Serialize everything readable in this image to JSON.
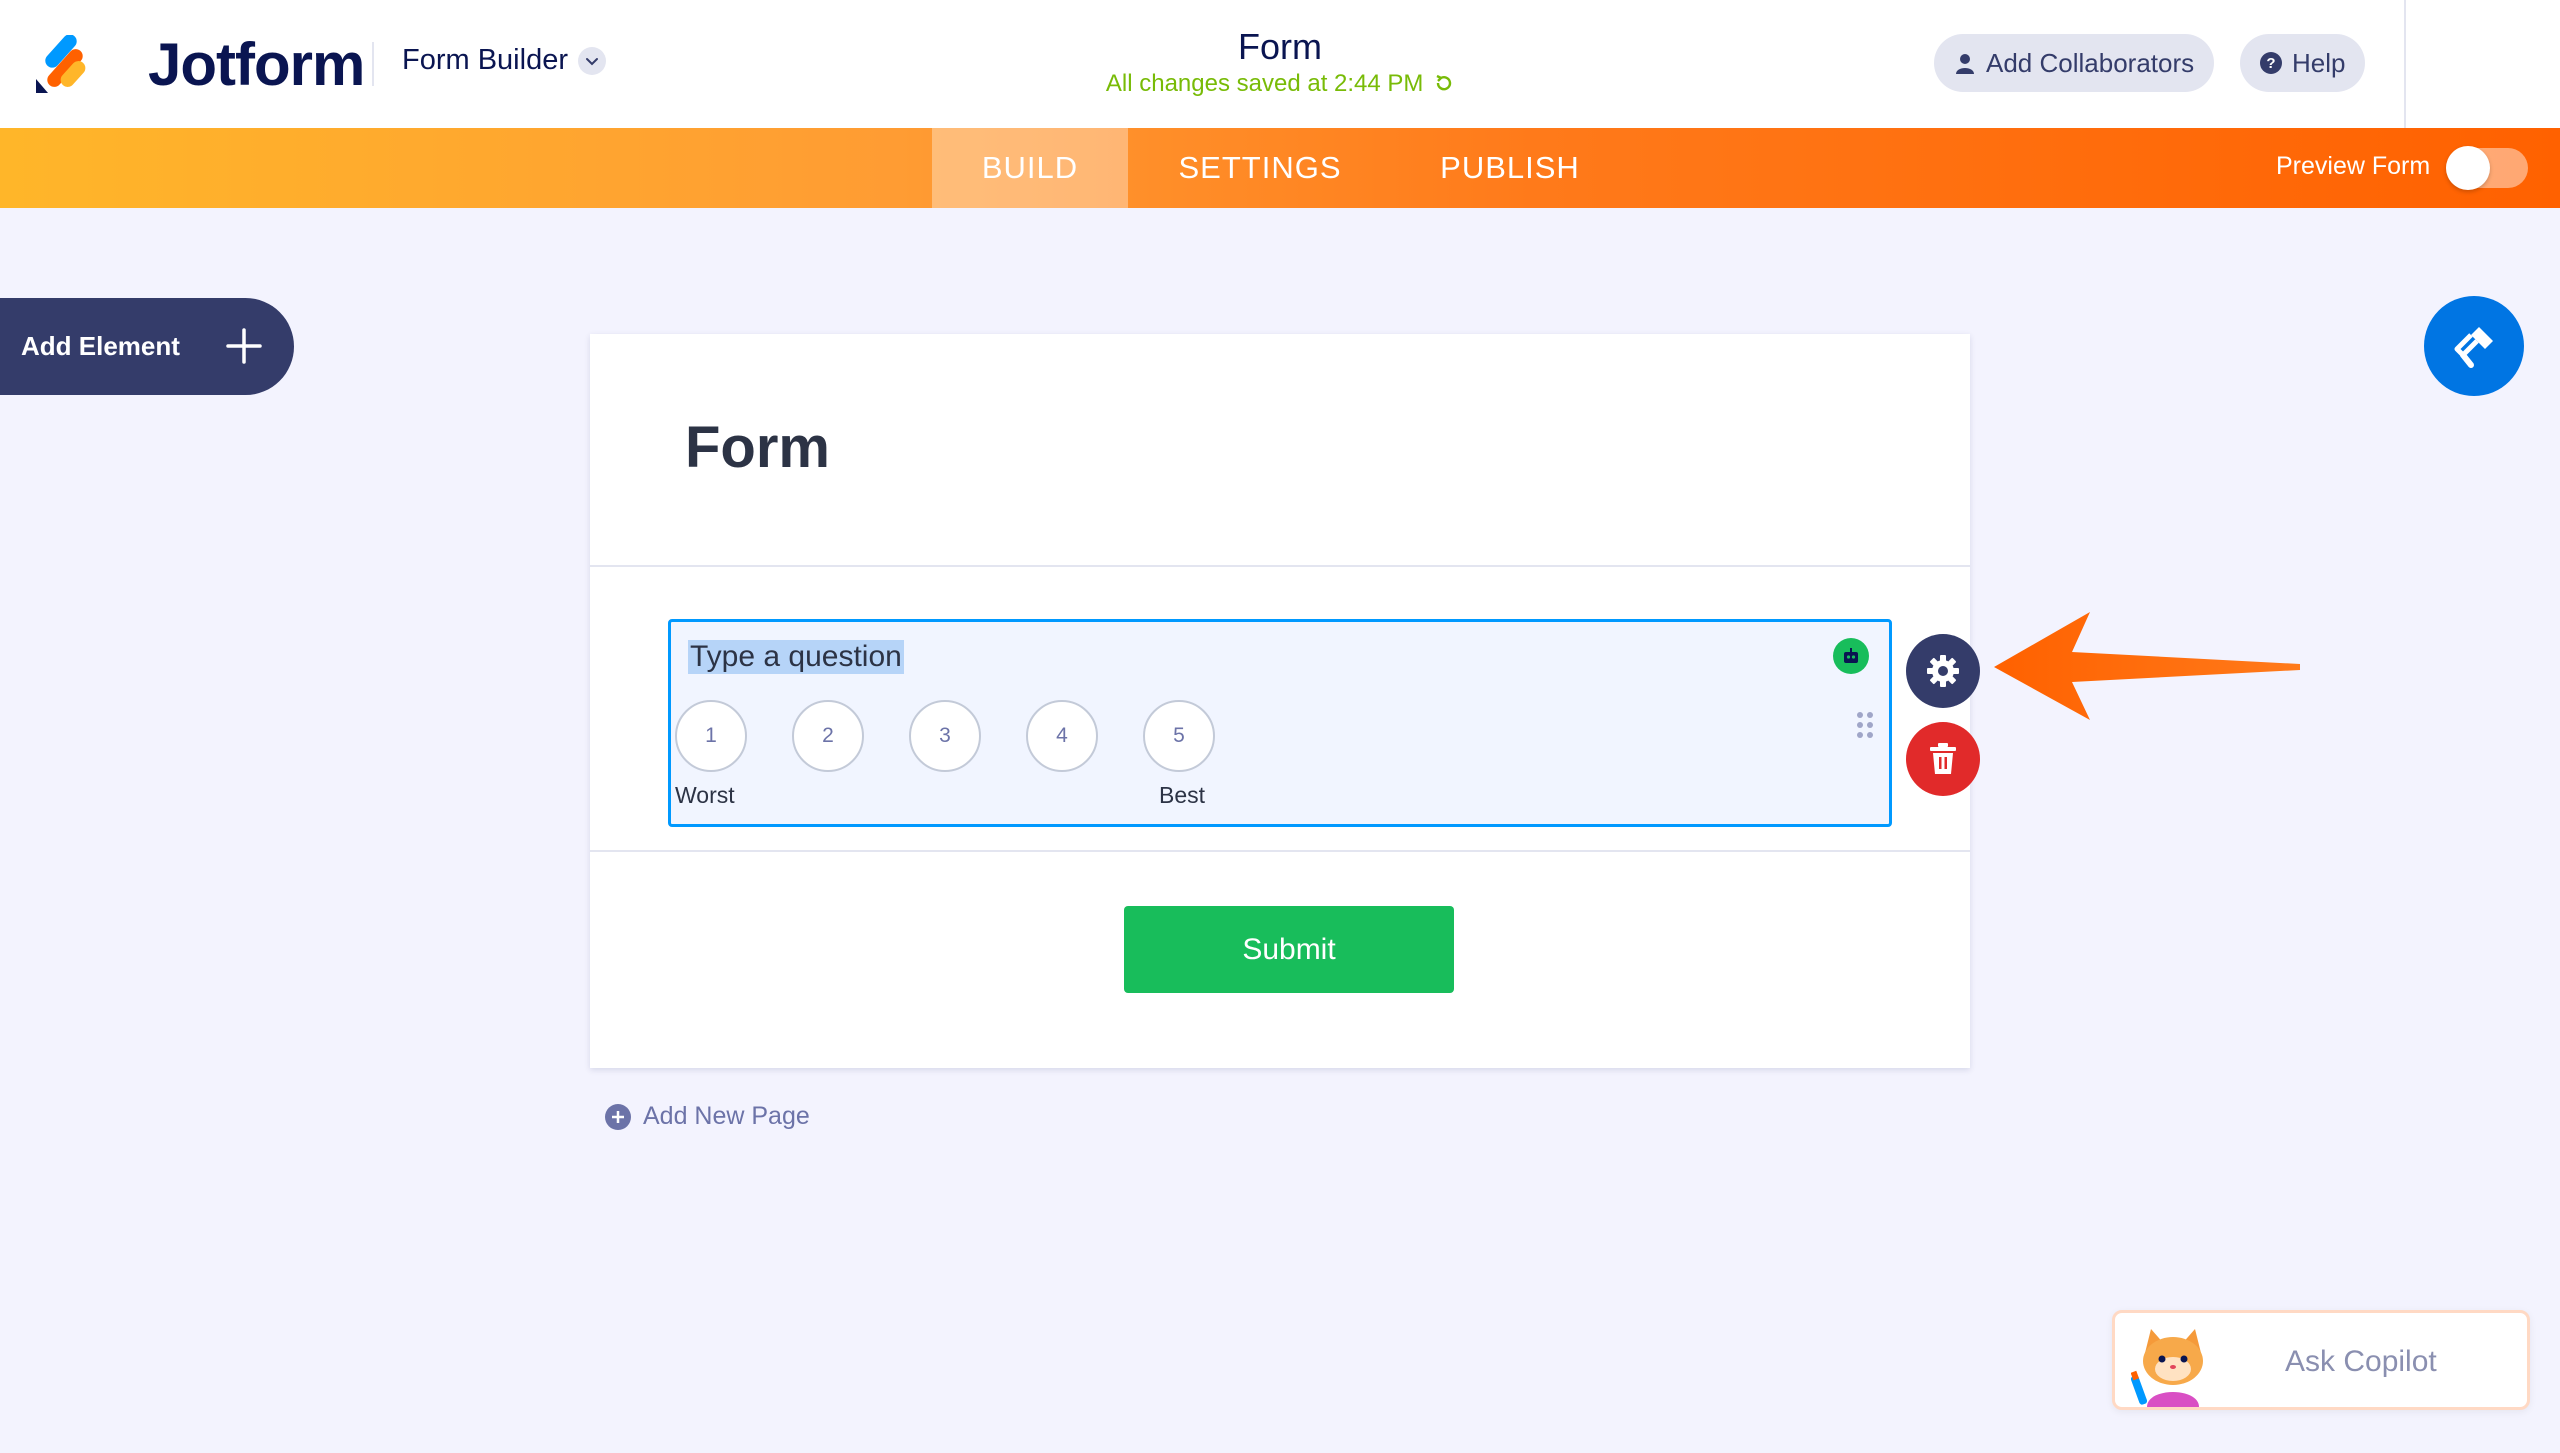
{
  "header": {
    "brand": "Jotform",
    "builder_label": "Form Builder",
    "form_title": "Form",
    "saved_status": "All changes saved at 2:44 PM",
    "add_collaborators": "Add Collaborators",
    "help": "Help"
  },
  "nav": {
    "tabs": [
      {
        "label": "BUILD",
        "active": true
      },
      {
        "label": "SETTINGS",
        "active": false
      },
      {
        "label": "PUBLISH",
        "active": false
      }
    ],
    "preview_label": "Preview Form",
    "preview_on": false
  },
  "sidebar": {
    "add_element_label": "Add Element"
  },
  "form": {
    "heading": "Form",
    "question": {
      "label": "Type a question",
      "scale": [
        "1",
        "2",
        "3",
        "4",
        "5"
      ],
      "low_label": "Worst",
      "high_label": "Best"
    },
    "submit_label": "Submit",
    "add_page_label": "Add New Page"
  },
  "copilot": {
    "label": "Ask Copilot"
  },
  "colors": {
    "brand_navy": "#0a1551",
    "accent_orange": "#ff6100",
    "selection_blue": "#0099ff",
    "submit_green": "#18bd5b",
    "delete_red": "#e12a2a",
    "designer_blue": "#0075e3",
    "saved_green": "#78bb07"
  },
  "icons": [
    "jotform-logo-icon",
    "chevron-down-icon",
    "user-icon",
    "help-icon",
    "plus-icon",
    "paint-roller-icon",
    "ai-robot-icon",
    "drag-handle-icon",
    "gear-icon",
    "trash-icon",
    "add-circle-icon",
    "arrow-annotation-icon",
    "copilot-cat-icon"
  ]
}
